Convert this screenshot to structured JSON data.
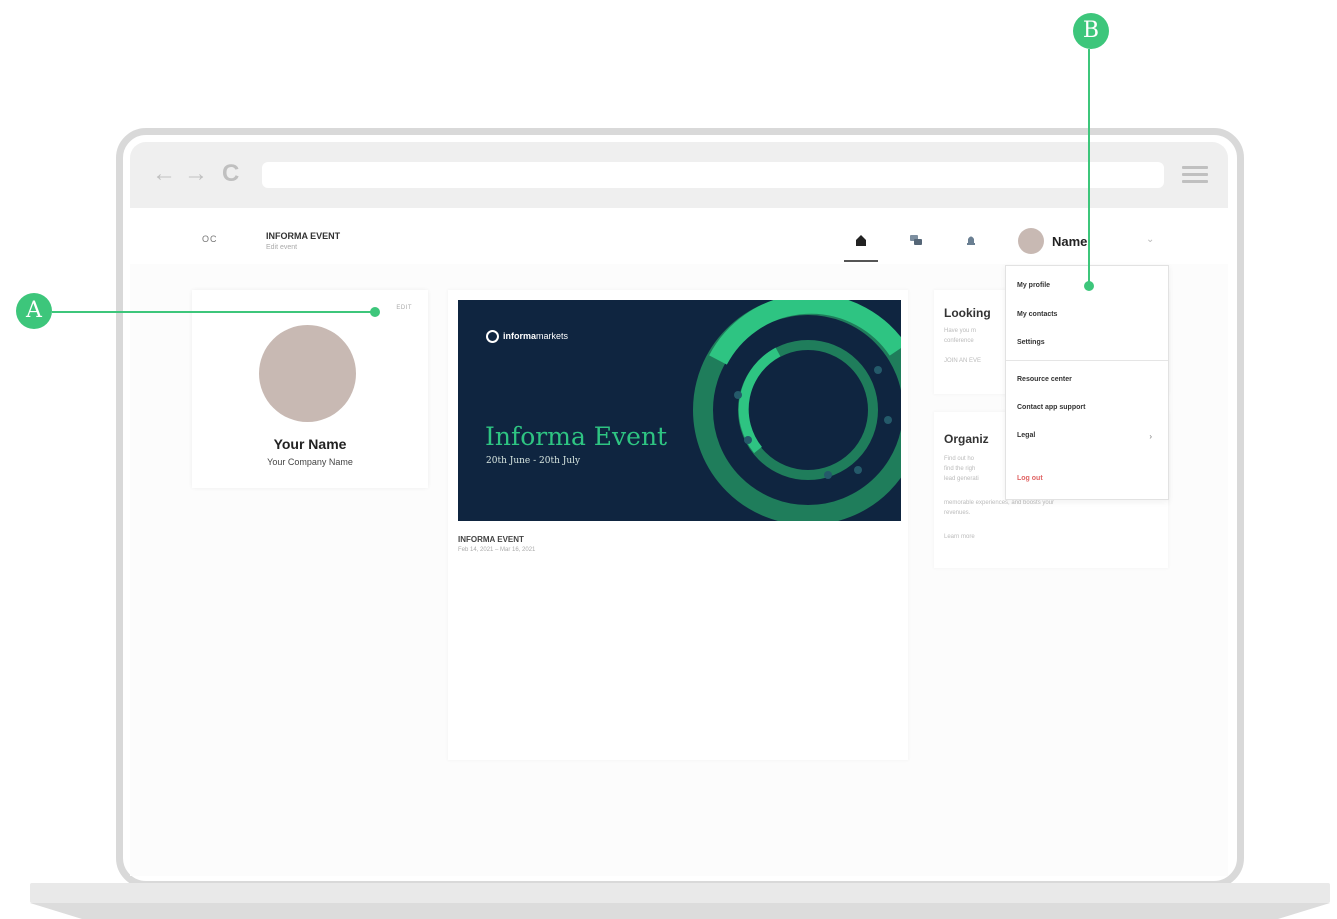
{
  "browser": {
    "back_icon": "←",
    "forward_icon": "→",
    "reload_icon": "C",
    "address": ""
  },
  "header": {
    "back_label": "OC",
    "event_title": "INFORMA EVENT",
    "event_sub": "Edit event",
    "user_name": "Name",
    "chevron": "⌄"
  },
  "profile": {
    "edit_label": "EDIT",
    "name": "Your Name",
    "company": "Your Company Name"
  },
  "event_card": {
    "banner_logo_bold": "informa",
    "banner_logo_rest": "markets",
    "banner_title": "Informa Event",
    "banner_dates": "20th June - 20th July",
    "name": "INFORMA EVENT",
    "dates": "Feb 14, 2021 – Mar 16, 2021"
  },
  "side_cards": {
    "card1_title": "Looking",
    "card1_lines": [
      "Have you m",
      "conference",
      "JOIN AN EVE"
    ],
    "card2_title": "Organiz",
    "card2_lines": [
      "Find out ho",
      "find the righ",
      "lead generati",
      "memorable experiences, and boosts your",
      "revenues.",
      "Learn more"
    ]
  },
  "dropdown": {
    "items": [
      "My profile",
      "My contacts",
      "Settings",
      "Resource center",
      "Contact app support",
      "Legal",
      "Log out"
    ],
    "legal_arrow": "›"
  },
  "annotations": {
    "a_label": "A",
    "b_label": "B",
    "accent": "#3dc67b"
  }
}
